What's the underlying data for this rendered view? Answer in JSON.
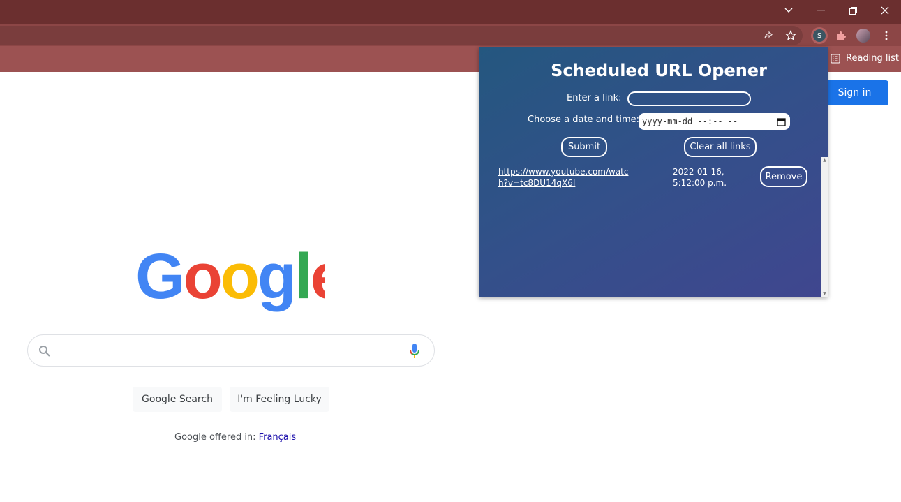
{
  "browser": {
    "reading_list_label": "Reading list",
    "profile_initial": "S"
  },
  "google": {
    "sign_in_label": "Sign in",
    "search_button_label": "Google Search",
    "lucky_button_label": "I'm Feeling Lucky",
    "offered_in_label": "Google offered in:",
    "language_link": "Français",
    "colors": {
      "blue": "#4285F4",
      "red": "#EA4335",
      "yellow": "#FBBC05",
      "green": "#34A853"
    }
  },
  "popup": {
    "title": "Scheduled URL Opener",
    "link_label": "Enter a link:",
    "datetime_label": "Choose a date and time:",
    "datetime_placeholder": "yyyy-mm-dd --:-- --",
    "submit_label": "Submit",
    "clear_label": "Clear all links",
    "entries": [
      {
        "url": "https://www.youtube.com/watch?v=tc8DU14qX6I",
        "when": "2022-01-16, 5:12:00 p.m.",
        "remove_label": "Remove"
      }
    ]
  }
}
